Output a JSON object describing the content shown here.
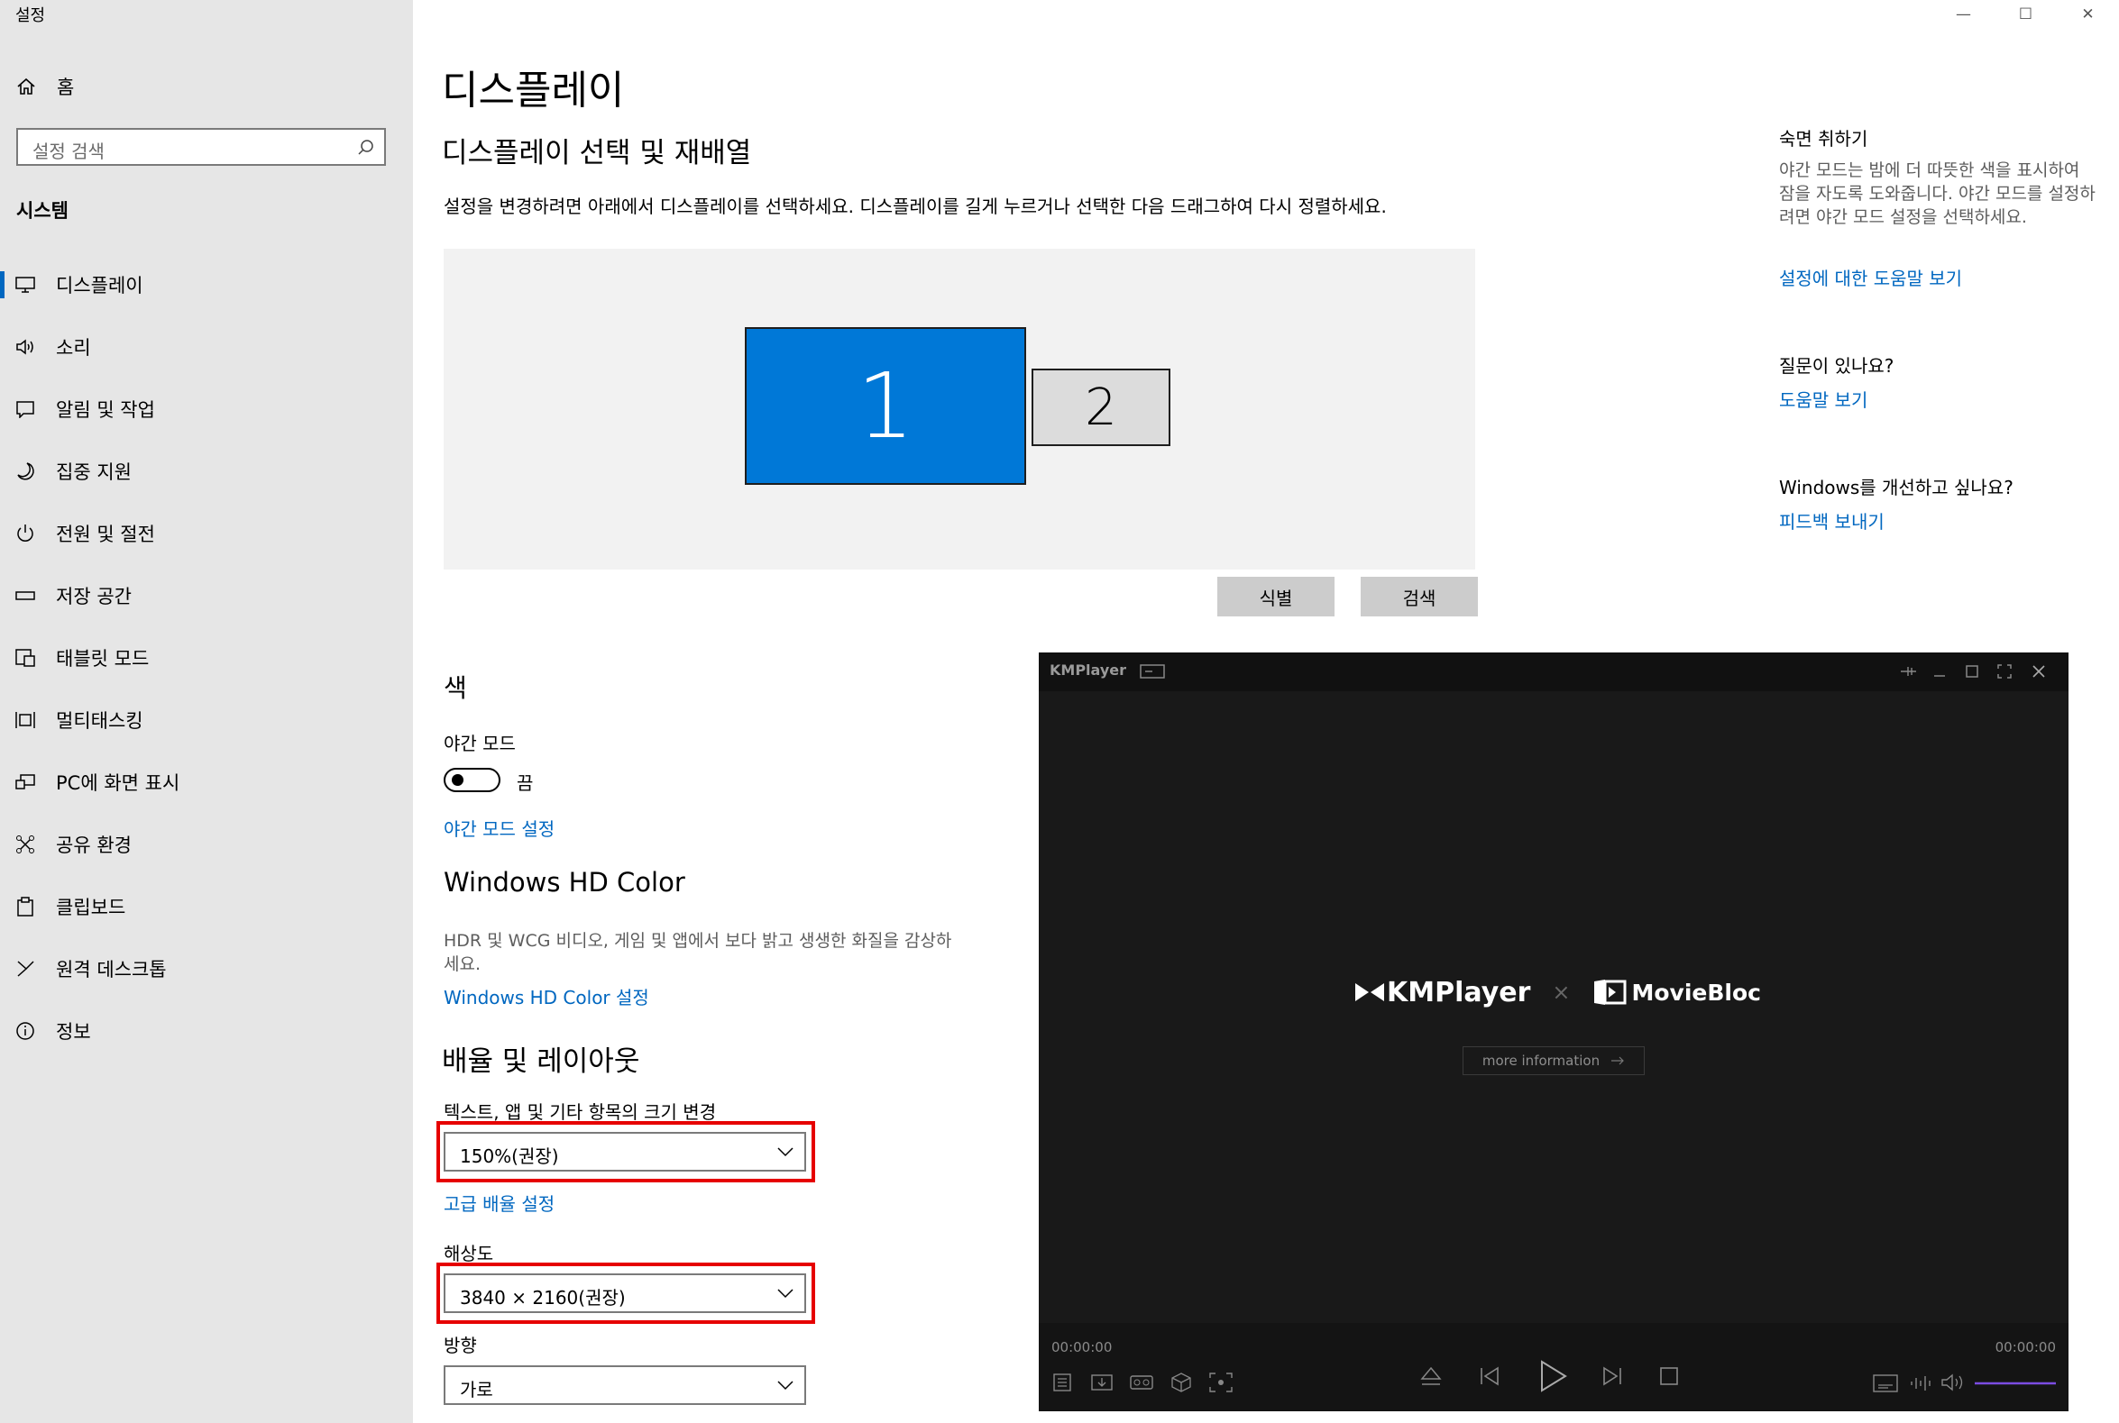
{
  "window": {
    "app_title": "설정",
    "minimize": "—",
    "maximize": "☐",
    "close": "✕"
  },
  "sidebar": {
    "home": "홈",
    "search_placeholder": "설정 검색",
    "section": "시스템",
    "items": [
      {
        "label": "디스플레이",
        "icon": "monitor-icon"
      },
      {
        "label": "소리",
        "icon": "speaker-icon"
      },
      {
        "label": "알림 및 작업",
        "icon": "notification-icon"
      },
      {
        "label": "집중 지원",
        "icon": "moon-icon"
      },
      {
        "label": "전원 및 절전",
        "icon": "power-icon"
      },
      {
        "label": "저장 공간",
        "icon": "storage-icon"
      },
      {
        "label": "태블릿 모드",
        "icon": "tablet-icon"
      },
      {
        "label": "멀티태스킹",
        "icon": "multitask-icon"
      },
      {
        "label": "PC에 화면 표시",
        "icon": "project-icon"
      },
      {
        "label": "공유 환경",
        "icon": "share-icon"
      },
      {
        "label": "클립보드",
        "icon": "clipboard-icon"
      },
      {
        "label": "원격 데스크톱",
        "icon": "remote-icon"
      },
      {
        "label": "정보",
        "icon": "info-icon"
      }
    ]
  },
  "main": {
    "title": "디스플레이",
    "arrange_heading": "디스플레이 선택 및 재배열",
    "arrange_desc": "설정을 변경하려면 아래에서 디스플레이를 선택하세요. 디스플레이를 길게 누르거나 선택한 다음 드래그하여 다시 정렬하세요.",
    "monitor1": "1",
    "monitor2": "2",
    "identify_button": "식별",
    "detect_button": "검색",
    "color_heading": "색",
    "night_mode_label": "야간 모드",
    "night_mode_state": "끔",
    "night_mode_link": "야간 모드 설정",
    "hd_heading": "Windows HD Color",
    "hd_desc_1": "HDR 및 WCG 비디오, 게임 및 앱에서 보다 밝고 생생한 화질을 감상하",
    "hd_desc_2": "세요.",
    "hd_link": "Windows HD Color 설정",
    "scale_heading": "배율 및 레이아웃",
    "scale_label": "텍스트, 앱 및 기타 항목의 크기 변경",
    "scale_value": "150%(권장)",
    "advanced_scale_link": "고급 배율 설정",
    "resolution_label": "해상도",
    "resolution_value": "3840 × 2160(권장)",
    "orientation_label": "방향",
    "orientation_value": "가로"
  },
  "right_pane": {
    "sleep_title": "숙면 취하기",
    "sleep_desc": "야간 모드는 밤에 더 따뜻한 색을 표시하여 잠을 자도록 도와줍니다. 야간 모드를 설정하려면 야간 모드 설정을 선택하세요.",
    "sleep_link": "설정에 대한 도움말 보기",
    "question_title": "질문이 있나요?",
    "question_link": "도움말 보기",
    "improve_title": "Windows를 개선하고 싶나요?",
    "improve_link": "피드백 보내기"
  },
  "kmplayer": {
    "title": "KMPlayer",
    "logo_left": "KMPlayer",
    "logo_sep": "×",
    "logo_right": "MovieBloc",
    "more_info": "more information",
    "time_current": "00:00:00",
    "time_total": "00:00:00"
  },
  "colors": {
    "accent": "#0067c0",
    "monitor_selected": "#0078d7",
    "highlight_box": "#e60000",
    "kmp_bg": "#191919"
  }
}
